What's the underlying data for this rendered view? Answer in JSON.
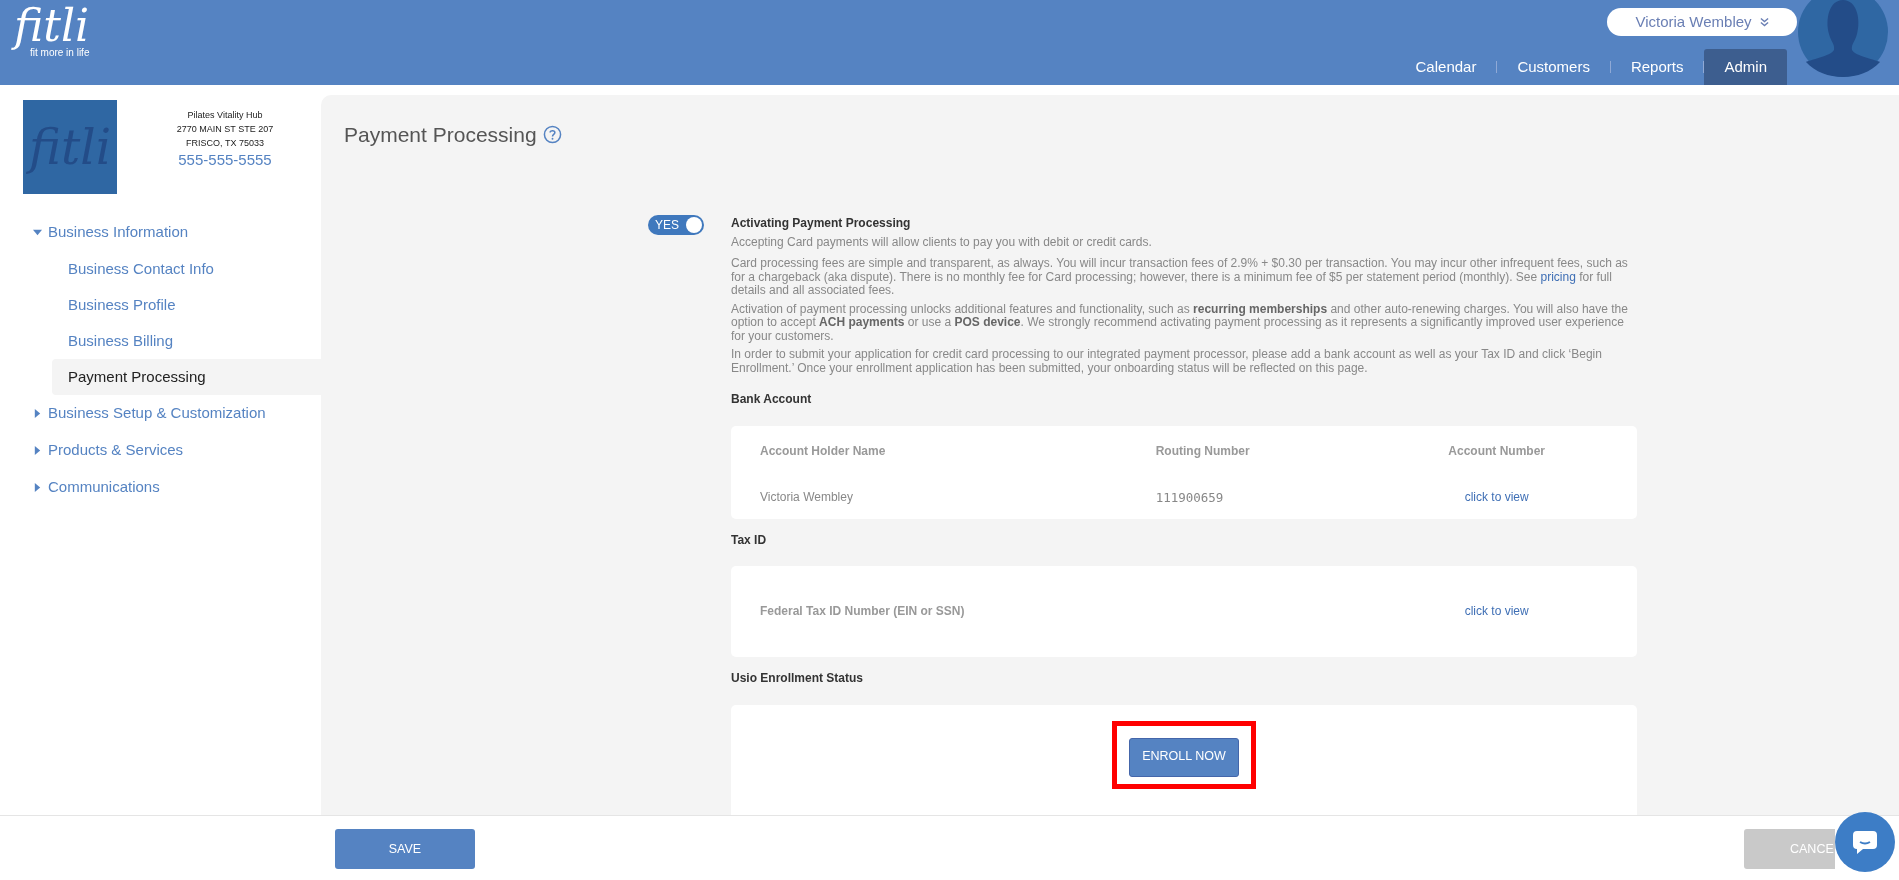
{
  "header": {
    "logo": {
      "wordmark": "fitli",
      "tagline": "fit more in life"
    },
    "user_menu": {
      "name": "Victoria Wembley"
    },
    "nav": [
      {
        "label": "Calendar",
        "selected": false
      },
      {
        "label": "Customers",
        "selected": false
      },
      {
        "label": "Reports",
        "selected": false
      },
      {
        "label": "Admin",
        "selected": true
      }
    ]
  },
  "business": {
    "logo_text": "fitli",
    "name": "Pilates Vitality Hub",
    "address_line_1": "2770 MAIN ST STE 207",
    "address_line_2": "FRISCO, TX 75033",
    "phone": "555-555-5555"
  },
  "sidebar": {
    "items": [
      {
        "label": "Business Information",
        "expanded": true,
        "children": [
          {
            "label": "Business Contact Info",
            "selected": false
          },
          {
            "label": "Business Profile",
            "selected": false
          },
          {
            "label": "Business Billing",
            "selected": false
          },
          {
            "label": "Payment Processing",
            "selected": true
          }
        ]
      },
      {
        "label": "Business Setup & Customization",
        "expanded": false
      },
      {
        "label": "Products & Services",
        "expanded": false
      },
      {
        "label": "Communications",
        "expanded": false
      }
    ]
  },
  "page": {
    "title": "Payment Processing",
    "toggle": {
      "label": "YES",
      "on": true
    },
    "heading": "Activating Payment Processing",
    "intro": "Accepting Card payments will allow clients to pay you with debit or credit cards.",
    "fees": {
      "before": "Card processing fees are simple and transparent, as always. You will incur transaction fees of 2.9% + $0.30 per transaction. You may incur other infrequent fees, such as for a chargeback (aka dispute). There is no monthly fee for Card processing; however, there is a minimum fee of $5 per statement period (monthly). See",
      "link": "pricing",
      "after": "for full details and all associated fees."
    },
    "features": "Activation of payment processing unlocks additional features and functionality, such as **recurring memberships** and other auto-renewing charges. You will also have the option to accept **ACH payments** or use a **POS device**. We strongly recommend activating payment processing as it represents a significantly improved user experience for your customers.",
    "enrollment_note": "In order to submit your application for credit card processing to our integrated payment processor, please add a bank account as well as your Tax ID and click ‘Begin Enrollment.’ Once your enrollment application has been submitted, your onboarding status will be reflected on this page.",
    "bank_account": {
      "title": "Bank Account",
      "columns": [
        "Account Holder Name",
        "Routing Number",
        "Account Number"
      ],
      "row": {
        "holder": "Victoria Wembley",
        "routing": "111900659",
        "account_link": "click to view"
      }
    },
    "tax_id": {
      "title": "Tax ID",
      "label": "Federal Tax ID Number (EIN or SSN)",
      "link": "click to view"
    },
    "enrollment": {
      "title": "Usio Enrollment Status",
      "button": "ENROLL NOW",
      "highlighted": true
    }
  },
  "footer": {
    "save": "SAVE",
    "cancel": "CANCE"
  }
}
